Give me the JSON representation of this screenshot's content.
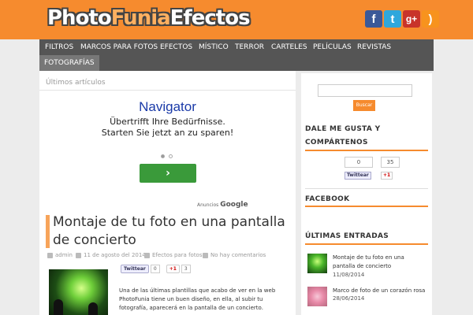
{
  "header": {
    "logo_part1": "Photo",
    "logo_part2": "Funia",
    "logo_part3": "Efectos",
    "social": [
      {
        "icon": "facebook-icon",
        "glyph": "f"
      },
      {
        "icon": "twitter-icon",
        "glyph": "t"
      },
      {
        "icon": "google-plus-icon",
        "glyph": "g+"
      },
      {
        "icon": "rss-icon",
        "glyph": ")"
      }
    ]
  },
  "nav": {
    "items": [
      "Filtros",
      "Marcos para fotos",
      "Efectos",
      "Místico",
      "Terror",
      "Carteles",
      "Películas",
      "Revistas"
    ],
    "active": "Fotografías"
  },
  "main": {
    "section_label": "Últimos artículos",
    "ad": {
      "title": "Navigator",
      "text": "Übertrifft Ihre Bedürfnisse. Starten Sie jetzt an zu sparen!",
      "button_glyph": "›",
      "by_prefix": "Anuncios",
      "by_brand": "Google"
    },
    "post": {
      "title": "Montaje de tu foto en una pantalla de concierto",
      "author": "admin",
      "date": "11 de agosto del 2014",
      "category": "Efectos para fotos",
      "comments": "No hay comentarios",
      "tweet_label": "Twittear",
      "tweet_count": "0",
      "gplus_label": "+1",
      "gplus_count": "3",
      "excerpt": "Una de las últimas plantillas que acabo de ver en la web PhotoFunia tiene un buen diseño, en ella, al subir tu fotografía, aparecerá en la pantalla de un concierto."
    }
  },
  "sidebar": {
    "search_placeholder": "",
    "search_button": "Buscar",
    "like_title_line1": "DALE ME GUSTA Y",
    "like_title_line2": "COMPÁRTENOS",
    "like_count": "0",
    "gplus_count": "35",
    "tweet_label": "Twittear",
    "gplus_label": "+1",
    "facebook_title": "FACEBOOK",
    "latest_title": "ÚLTIMAS ENTRADAS",
    "entries": [
      {
        "title": "Montaje de tu foto en una pantalla de concierto",
        "date": "11/08/2014"
      },
      {
        "title": "Marco de foto de un corazón rosa",
        "date": "28/06/2014"
      }
    ]
  }
}
